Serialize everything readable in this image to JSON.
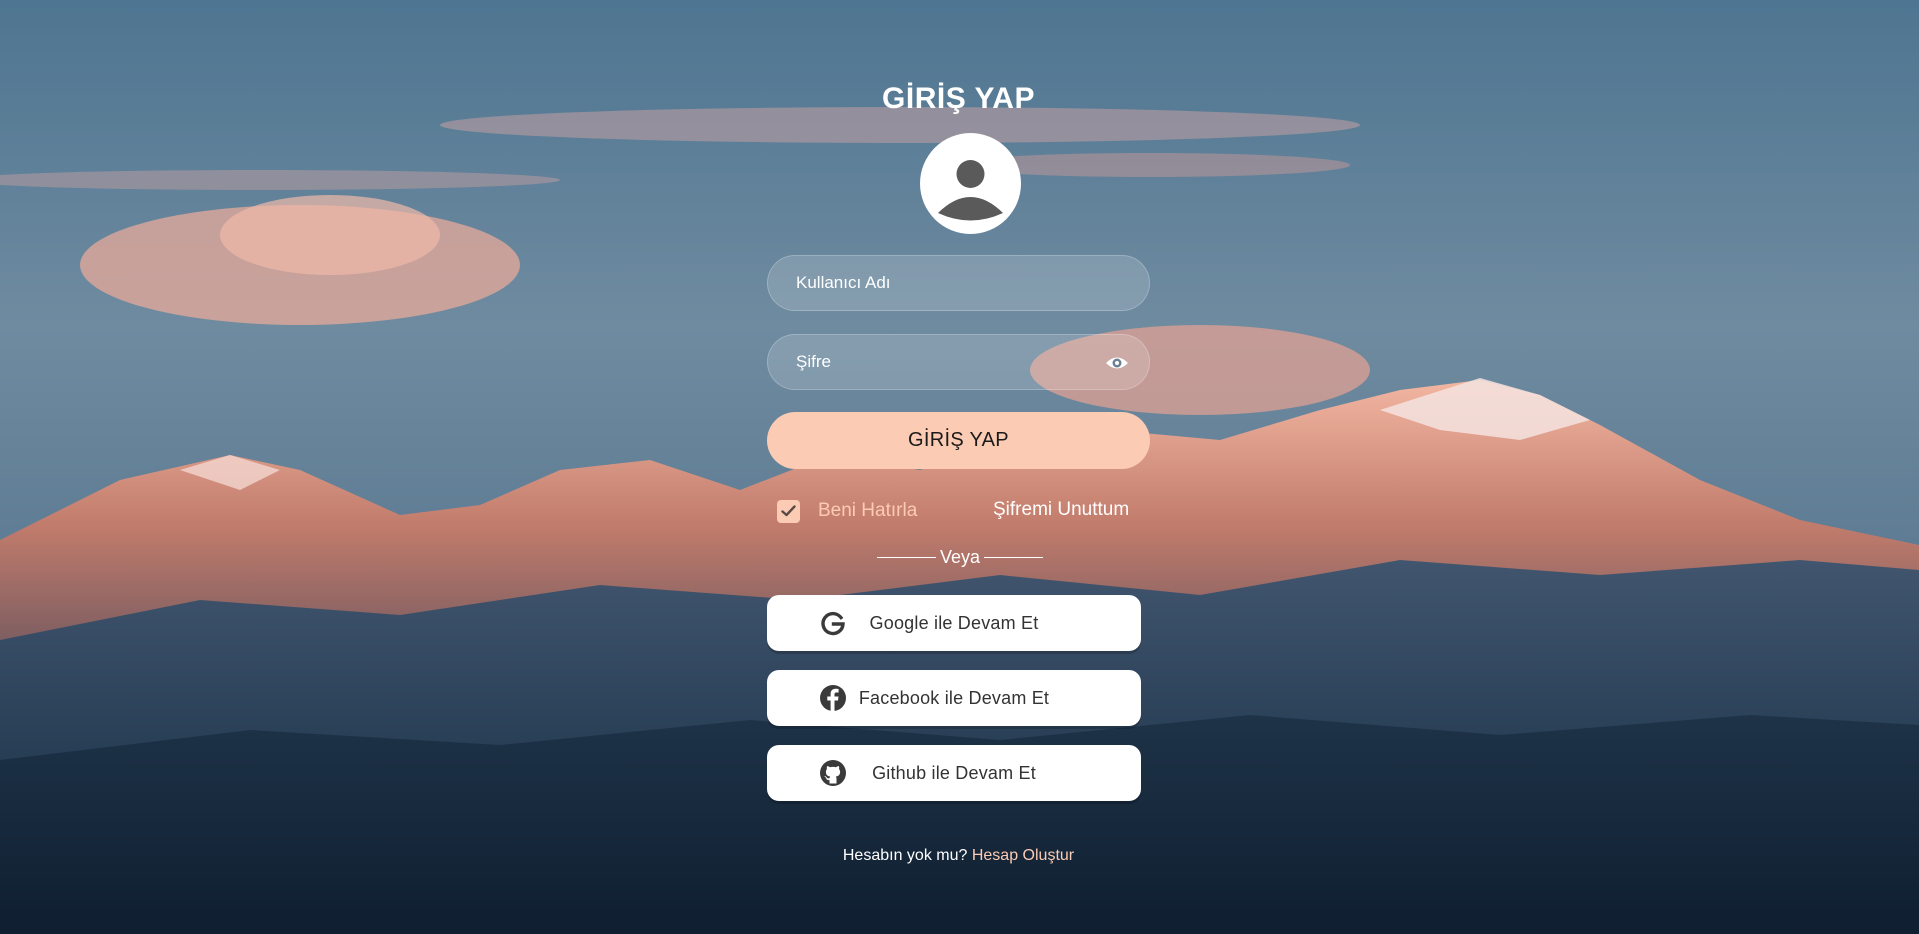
{
  "login": {
    "title": "GİRİŞ YAP",
    "username_placeholder": "Kullanıcı Adı",
    "password_placeholder": "Şifre",
    "submit_label": "GİRİŞ YAP",
    "remember_label": "Beni Hatırla",
    "remember_checked": true,
    "forgot_label": "Şifremi Unuttum",
    "divider_label": "Veya",
    "social": [
      {
        "label": "Google ile Devam Et",
        "icon": "google-icon"
      },
      {
        "label": "Facebook ile Devam Et",
        "icon": "facebook-icon"
      },
      {
        "label": "Github ile Devam Et",
        "icon": "github-icon"
      }
    ],
    "signup_prompt": "Hesabın yok mu?",
    "signup_link": "Hesap Oluştur"
  },
  "colors": {
    "accent": "#fccbb3",
    "text": "#ffffff"
  }
}
